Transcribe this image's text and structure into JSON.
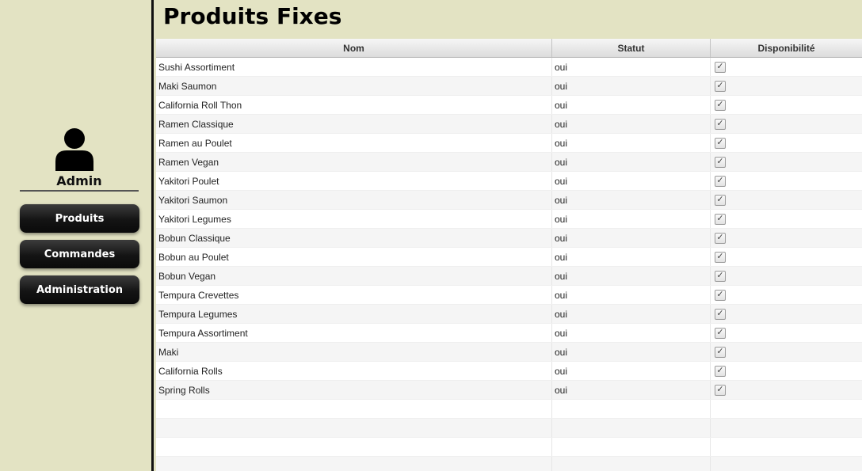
{
  "sidebar": {
    "user_name": "Admin",
    "nav": [
      {
        "label": "Produits"
      },
      {
        "label": "Commandes"
      },
      {
        "label": "Administration"
      }
    ]
  },
  "main": {
    "title": "Produits Fixes"
  },
  "table": {
    "columns": [
      "Nom",
      "Statut",
      "Disponibilité"
    ],
    "rows": [
      {
        "name": "Sushi Assortiment",
        "status": "oui",
        "available": true
      },
      {
        "name": "Maki Saumon",
        "status": "oui",
        "available": true
      },
      {
        "name": "California Roll Thon",
        "status": "oui",
        "available": true
      },
      {
        "name": "Ramen Classique",
        "status": "oui",
        "available": true
      },
      {
        "name": "Ramen au Poulet",
        "status": "oui",
        "available": true
      },
      {
        "name": "Ramen Vegan",
        "status": "oui",
        "available": true
      },
      {
        "name": "Yakitori Poulet",
        "status": "oui",
        "available": true
      },
      {
        "name": "Yakitori Saumon",
        "status": "oui",
        "available": true
      },
      {
        "name": "Yakitori Legumes",
        "status": "oui",
        "available": true
      },
      {
        "name": "Bobun Classique",
        "status": "oui",
        "available": true
      },
      {
        "name": "Bobun au Poulet",
        "status": "oui",
        "available": true
      },
      {
        "name": "Bobun Vegan",
        "status": "oui",
        "available": true
      },
      {
        "name": "Tempura Crevettes",
        "status": "oui",
        "available": true
      },
      {
        "name": "Tempura Legumes",
        "status": "oui",
        "available": true
      },
      {
        "name": "Tempura Assortiment",
        "status": "oui",
        "available": true
      },
      {
        "name": "Maki",
        "status": "oui",
        "available": true
      },
      {
        "name": "California Rolls",
        "status": "oui",
        "available": true
      },
      {
        "name": "Spring Rolls",
        "status": "oui",
        "available": true
      }
    ]
  },
  "icons": {
    "user": "user-icon",
    "check": "checkmark-icon"
  },
  "colors": {
    "background": "#e3e3c3",
    "button": "#141414",
    "button_text": "#ffffff"
  }
}
